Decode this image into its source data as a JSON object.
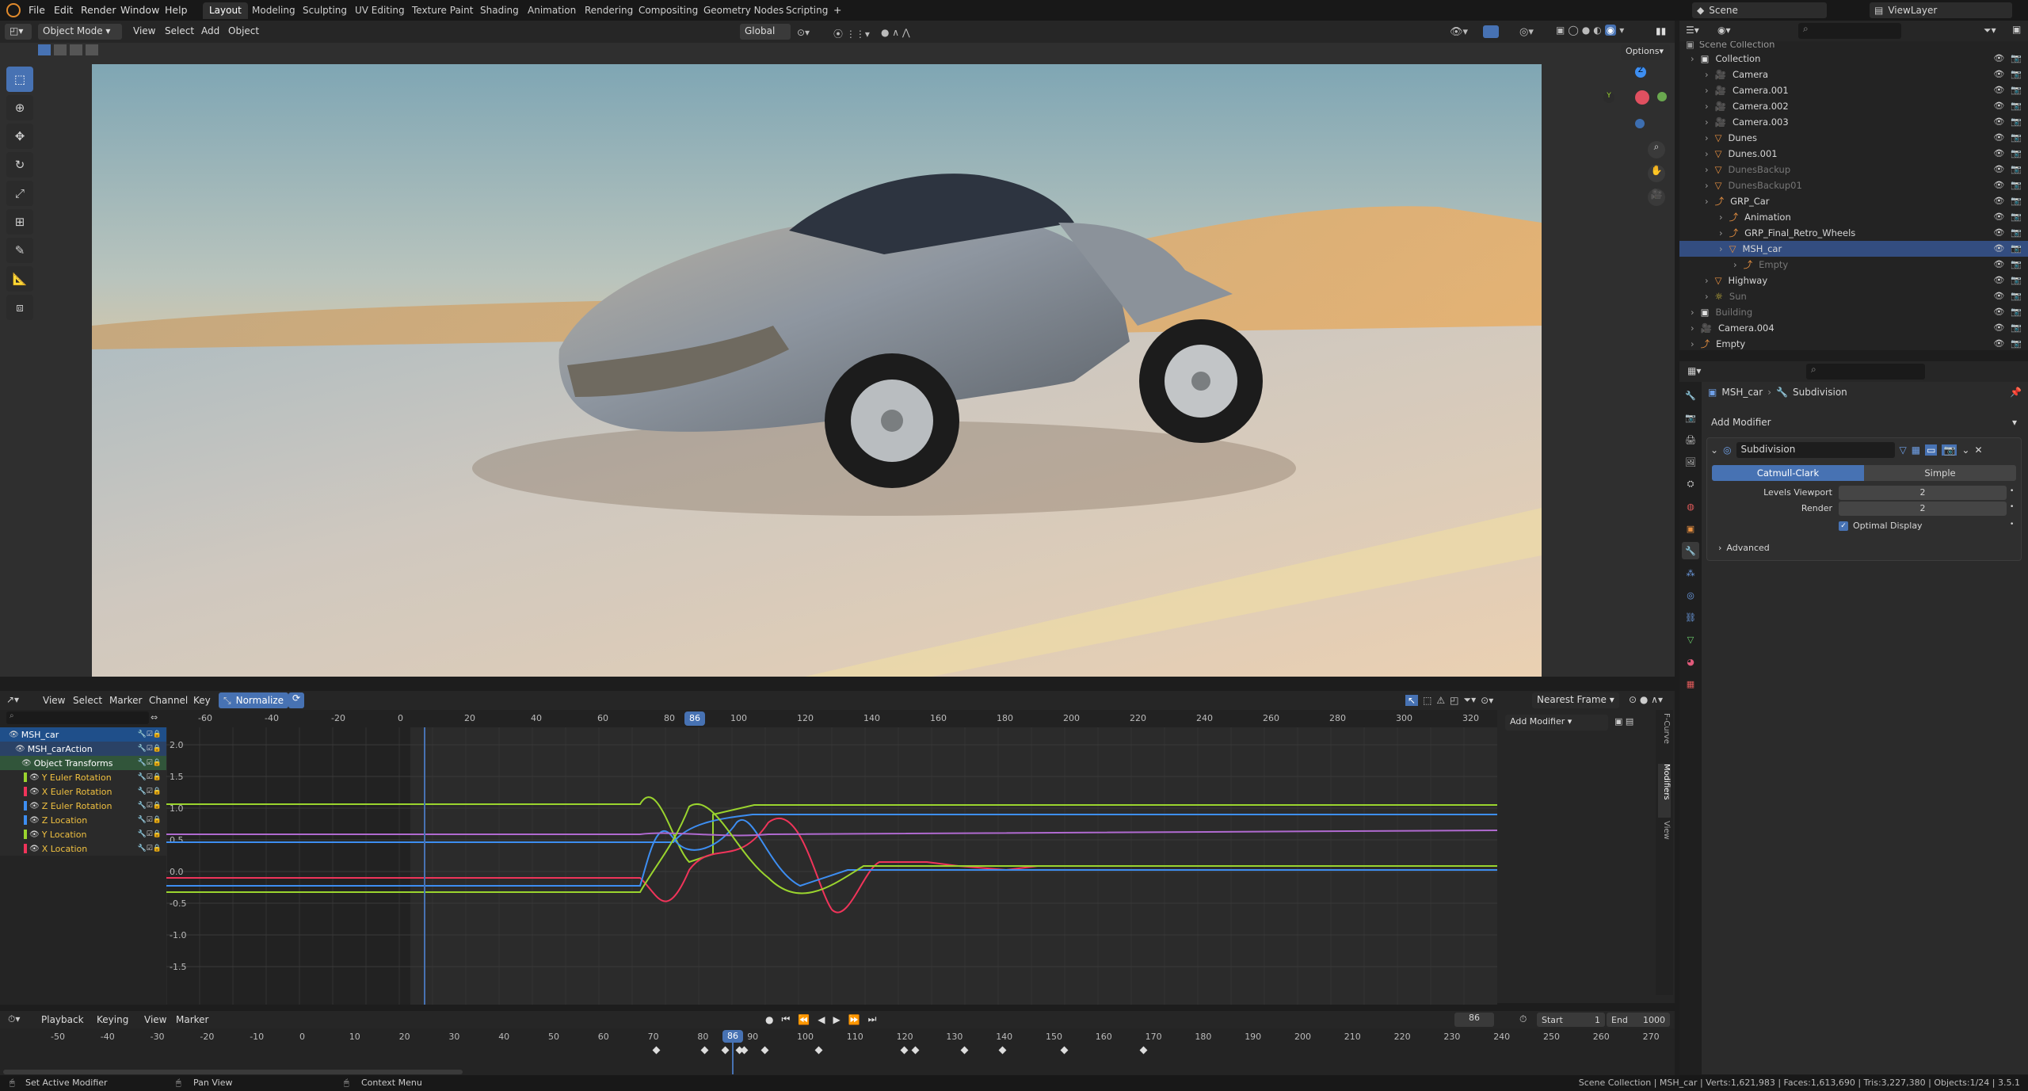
{
  "menubar": {
    "items": [
      "File",
      "Edit",
      "Render",
      "Window",
      "Help"
    ],
    "workspaces": [
      "Layout",
      "Modeling",
      "Sculpting",
      "UV Editing",
      "Texture Paint",
      "Shading",
      "Animation",
      "Rendering",
      "Compositing",
      "Geometry Nodes",
      "Scripting"
    ],
    "active_workspace": "Layout",
    "add_tab": "+",
    "scene_name": "Scene",
    "view_layer": "ViewLayer"
  },
  "viewport_header": {
    "mode": "Object Mode",
    "menus": [
      "View",
      "Select",
      "Add",
      "Object"
    ],
    "transform_orientation": "Global",
    "options": "Options"
  },
  "graph_editor": {
    "menus": [
      "View",
      "Select",
      "Marker",
      "Channel",
      "Key"
    ],
    "normalize_label": "Normalize",
    "snap_label": "Nearest Frame",
    "ruler_ticks": [
      "-60",
      "-40",
      "-20",
      "0",
      "20",
      "40",
      "60",
      "80",
      "100",
      "120",
      "140",
      "160",
      "180",
      "200",
      "220",
      "240",
      "260",
      "280",
      "300",
      "320"
    ],
    "current_frame": "86",
    "y_ticks": [
      "2.0",
      "1.5",
      "1.0",
      "0.5",
      "0.0",
      "-0.5",
      "-1.0",
      "-1.5"
    ],
    "add_modifier": "Add Modifier",
    "side_tabs": [
      "F-Curve",
      "Modifiers",
      "View"
    ],
    "channels": [
      {
        "label": "MSH_car",
        "type": "object",
        "color": "#1f4f8a"
      },
      {
        "label": "MSH_carAction",
        "type": "action",
        "color": "#2a4266"
      },
      {
        "label": "Object Transforms",
        "type": "group",
        "color": "#31553a"
      },
      {
        "label": "Y Euler Rotation",
        "type": "fcurve",
        "color": "#9ad42e"
      },
      {
        "label": "X Euler Rotation",
        "type": "fcurve",
        "color": "#f0345a"
      },
      {
        "label": "Z Euler Rotation",
        "type": "fcurve",
        "color": "#3d8ef2"
      },
      {
        "label": "Z Location",
        "type": "fcurve",
        "color": "#3d8ef2"
      },
      {
        "label": "Y Location",
        "type": "fcurve",
        "color": "#9ad42e"
      },
      {
        "label": "X Location",
        "type": "fcurve",
        "color": "#f0345a"
      }
    ]
  },
  "timeline": {
    "menus": [
      "Playback",
      "Keying",
      "View",
      "Marker"
    ],
    "current_frame": "86",
    "start_label": "Start",
    "start": "1",
    "end_label": "End",
    "end": "1000",
    "ruler_ticks": [
      "-50",
      "-40",
      "-30",
      "-20",
      "-10",
      "0",
      "10",
      "20",
      "30",
      "40",
      "50",
      "60",
      "70",
      "80",
      "90",
      "100",
      "110",
      "120",
      "130",
      "140",
      "150",
      "160",
      "170",
      "180",
      "190",
      "200",
      "210",
      "220",
      "230",
      "240",
      "250",
      "260",
      "270"
    ],
    "playhead": "86"
  },
  "statusbar": {
    "left_items": [
      "Set Active Modifier",
      "Pan View",
      "Context Menu"
    ],
    "stats": "Scene Collection | MSH_car | Verts:1,621,983 | Faces:1,613,690 | Tris:3,227,380 | Objects:1/24 | 3.5.1"
  },
  "outliner": {
    "root": "Scene Collection",
    "items": [
      {
        "label": "Collection",
        "depth": 0,
        "kind": "collection",
        "dim": false,
        "selected": false
      },
      {
        "label": "Camera",
        "depth": 1,
        "kind": "camera",
        "dim": false,
        "selected": false
      },
      {
        "label": "Camera.001",
        "depth": 1,
        "kind": "camera",
        "dim": false,
        "selected": false
      },
      {
        "label": "Camera.002",
        "depth": 1,
        "kind": "camera",
        "dim": false,
        "selected": false
      },
      {
        "label": "Camera.003",
        "depth": 1,
        "kind": "camera",
        "dim": false,
        "selected": false
      },
      {
        "label": "Dunes",
        "depth": 1,
        "kind": "mesh",
        "dim": false,
        "selected": false
      },
      {
        "label": "Dunes.001",
        "depth": 1,
        "kind": "mesh",
        "dim": false,
        "selected": false
      },
      {
        "label": "DunesBackup",
        "depth": 1,
        "kind": "mesh",
        "dim": true,
        "selected": false
      },
      {
        "label": "DunesBackup01",
        "depth": 1,
        "kind": "mesh",
        "dim": true,
        "selected": false
      },
      {
        "label": "GRP_Car",
        "depth": 1,
        "kind": "empty",
        "dim": false,
        "selected": false
      },
      {
        "label": "Animation",
        "depth": 2,
        "kind": "empty",
        "dim": false,
        "selected": false
      },
      {
        "label": "GRP_Final_Retro_Wheels",
        "depth": 2,
        "kind": "empty",
        "dim": false,
        "selected": false
      },
      {
        "label": "MSH_car",
        "depth": 2,
        "kind": "mesh",
        "dim": false,
        "selected": true
      },
      {
        "label": "Empty",
        "depth": 3,
        "kind": "empty",
        "dim": true,
        "selected": false
      },
      {
        "label": "Highway",
        "depth": 1,
        "kind": "mesh",
        "dim": false,
        "selected": false
      },
      {
        "label": "Sun",
        "depth": 1,
        "kind": "light",
        "dim": true,
        "selected": false
      },
      {
        "label": "Building",
        "depth": 0,
        "kind": "collection",
        "dim": true,
        "selected": false
      },
      {
        "label": "Camera.004",
        "depth": 0,
        "kind": "camera",
        "dim": false,
        "selected": false
      },
      {
        "label": "Empty",
        "depth": 0,
        "kind": "empty",
        "dim": false,
        "selected": false
      }
    ]
  },
  "properties": {
    "breadcrumb_object": "MSH_car",
    "breadcrumb_modifier": "Subdivision",
    "add_modifier": "Add Modifier",
    "modifier_name": "Subdivision",
    "mode_catmull": "Catmull-Clark",
    "mode_simple": "Simple",
    "levels_viewport_label": "Levels Viewport",
    "levels_viewport": "2",
    "render_label": "Render",
    "render_value": "2",
    "optimal_display": "Optimal Display",
    "advanced": "Advanced"
  },
  "colors": {
    "accent": "#4772b3",
    "selected_row": "#334d80",
    "curve_red": "#f0345a",
    "curve_green": "#9ad42e",
    "curve_blue": "#3d8ef2"
  }
}
